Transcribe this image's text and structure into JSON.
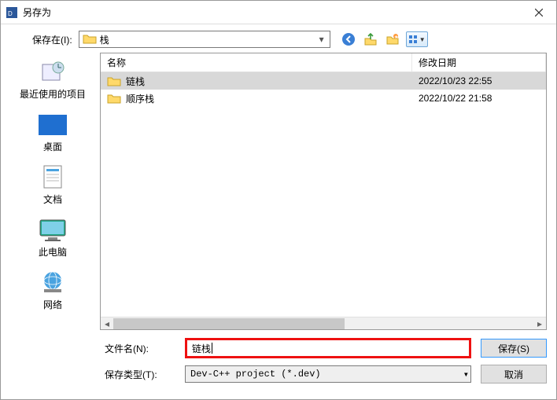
{
  "title": "另存为",
  "top": {
    "label": "保存在(I):",
    "current_folder": "栈"
  },
  "toolbar": {
    "back": "back-icon",
    "up": "up-icon",
    "newfolder": "new-folder-icon",
    "views": "views-icon"
  },
  "sidebar": {
    "items": [
      {
        "label": "最近使用的项目"
      },
      {
        "label": "桌面"
      },
      {
        "label": "文档"
      },
      {
        "label": "此电脑"
      },
      {
        "label": "网络"
      }
    ]
  },
  "columns": {
    "name": "名称",
    "date": "修改日期"
  },
  "files": [
    {
      "name": "链栈",
      "date": "2022/10/23 22:55",
      "selected": true
    },
    {
      "name": "顺序栈",
      "date": "2022/10/22 21:58",
      "selected": false
    }
  ],
  "form": {
    "filename_label": "文件名(N):",
    "filename_value": "链栈",
    "type_label": "保存类型(T):",
    "type_value": "Dev-C++ project (*.dev)",
    "save_label": "保存(S)",
    "cancel_label": "取消"
  }
}
